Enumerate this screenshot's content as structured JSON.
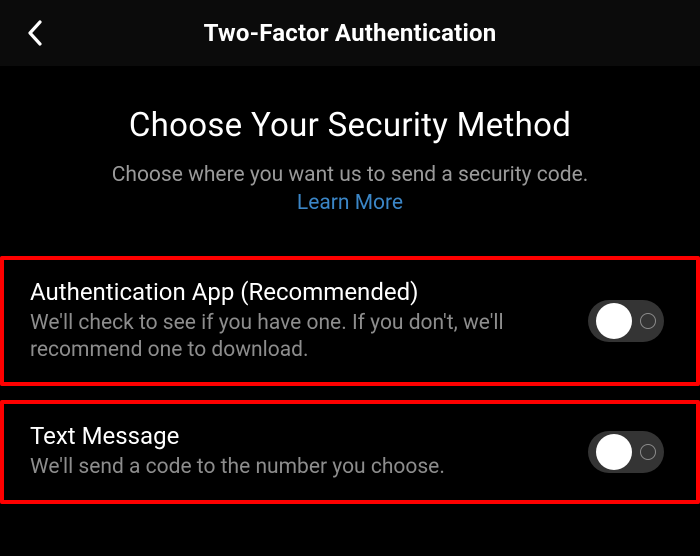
{
  "nav": {
    "title": "Two-Factor Authentication"
  },
  "hero": {
    "heading": "Choose Your Security Method",
    "subtext": "Choose where you want us to send a security code.",
    "learn_more": "Learn More"
  },
  "options": [
    {
      "title": "Authentication App (Recommended)",
      "description": "We'll check to see if you have one. If you don't, we'll recommend one to download.",
      "enabled": false
    },
    {
      "title": "Text Message",
      "description": "We'll send a code to the number you choose.",
      "enabled": false
    }
  ],
  "colors": {
    "highlight": "#fe0000",
    "link": "#3b86c7"
  }
}
